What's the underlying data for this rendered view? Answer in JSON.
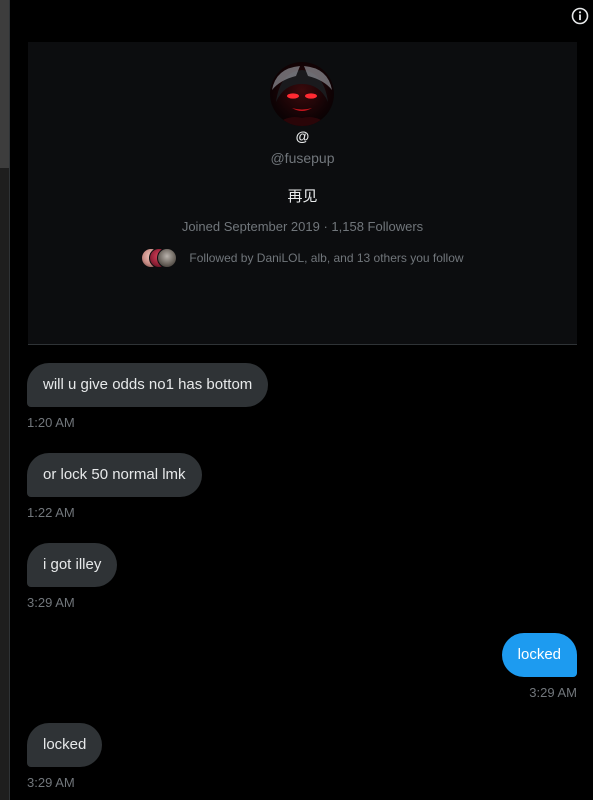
{
  "colors": {
    "background": "#000000",
    "card": "#0c0d0f",
    "incoming_bubble": "#2f3336",
    "outgoing_bubble": "#1d9bf0",
    "muted_text": "#71767b",
    "primary_text": "#e7e9ea"
  },
  "header": {
    "info_icon": "info-icon"
  },
  "profile": {
    "name": "@",
    "handle": "@fusepup",
    "bio": "再见",
    "meta": "Joined September 2019 · 1,158 Followers",
    "followed_by": "Followed by DaniLOL, alb, and 13 others you follow"
  },
  "messages": [
    {
      "direction": "in",
      "text": "will u give odds no1 has bottom",
      "time": "1:20 AM"
    },
    {
      "direction": "in",
      "text": "or lock 50 normal lmk",
      "time": "1:22 AM"
    },
    {
      "direction": "in",
      "text": "i got illey",
      "time": "3:29 AM"
    },
    {
      "direction": "out",
      "text": "locked",
      "time": "3:29 AM"
    },
    {
      "direction": "in",
      "text": "locked",
      "time": "3:29 AM"
    }
  ]
}
